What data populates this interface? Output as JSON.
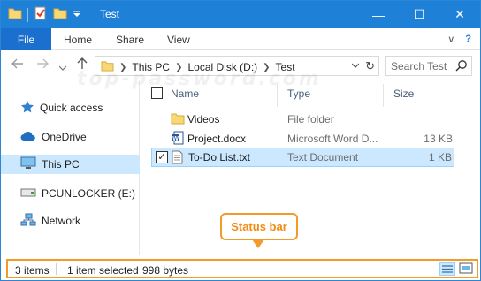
{
  "window": {
    "title": "Test",
    "accent": "#1f80d8"
  },
  "quick_access_toolbar": {
    "icons": [
      "folder-icon",
      "properties-icon",
      "new-folder-icon",
      "customize-dropdown-icon"
    ]
  },
  "window_buttons": {
    "minimize": "—",
    "maximize": "☐",
    "close": "✕"
  },
  "ribbon": {
    "file_label": "File",
    "tabs": [
      "Home",
      "Share",
      "View"
    ],
    "expand_glyph": "∨",
    "help_glyph": "?"
  },
  "address": {
    "crumbs": [
      "This PC",
      "Local Disk (D:)",
      "Test"
    ],
    "search_placeholder": "Search Test"
  },
  "watermark": "top-password.com",
  "nav_pane": {
    "items": [
      {
        "label": "Quick access",
        "icon": "star-icon",
        "selected": false
      },
      {
        "label": "OneDrive",
        "icon": "cloud-icon",
        "selected": false
      },
      {
        "label": "This PC",
        "icon": "computer-icon",
        "selected": true
      },
      {
        "label": "PCUNLOCKER (E:)",
        "icon": "drive-icon",
        "selected": false
      },
      {
        "label": "Network",
        "icon": "network-icon",
        "selected": false
      }
    ]
  },
  "columns": {
    "name": "Name",
    "type": "Type",
    "size": "Size"
  },
  "files": [
    {
      "name": "Videos",
      "type": "File folder",
      "size": "",
      "icon": "folder-icon",
      "selected": false
    },
    {
      "name": "Project.docx",
      "type": "Microsoft Word D...",
      "size": "13 KB",
      "icon": "word-document-icon",
      "selected": false
    },
    {
      "name": "To-Do List.txt",
      "type": "Text Document",
      "size": "1 KB",
      "icon": "text-file-icon",
      "selected": true
    }
  ],
  "callout": {
    "label": "Status bar",
    "color": "#f39a29"
  },
  "status_bar": {
    "item_count": "3 items",
    "selection": "1 item selected",
    "selection_size": "998 bytes"
  }
}
